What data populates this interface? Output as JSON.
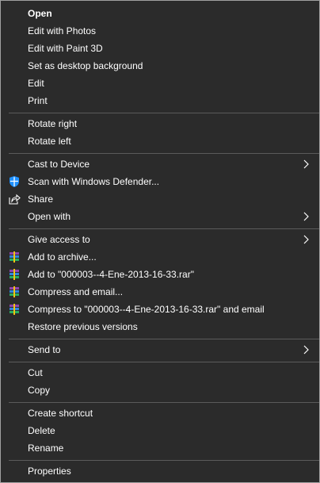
{
  "menu": {
    "items": {
      "open": "Open",
      "edit_photos": "Edit with Photos",
      "edit_paint3d": "Edit with Paint 3D",
      "set_desktop_bg": "Set as desktop background",
      "edit": "Edit",
      "print": "Print",
      "rotate_right": "Rotate right",
      "rotate_left": "Rotate left",
      "cast_to_device": "Cast to Device",
      "scan_defender": "Scan with Windows Defender...",
      "share": "Share",
      "open_with": "Open with",
      "give_access": "Give access to",
      "add_to_archive": "Add to archive...",
      "add_to_rar": "Add to \"000003--4-Ene-2013-16-33.rar\"",
      "compress_email": "Compress and email...",
      "compress_to_rar_email": "Compress to \"000003--4-Ene-2013-16-33.rar\" and email",
      "restore_versions": "Restore previous versions",
      "send_to": "Send to",
      "cut": "Cut",
      "copy": "Copy",
      "create_shortcut": "Create shortcut",
      "delete": "Delete",
      "rename": "Rename",
      "properties": "Properties"
    },
    "icons": {
      "defender": "shield-icon",
      "share": "share-icon",
      "winrar": "winrar-icon"
    },
    "colors": {
      "background": "#2b2b2b",
      "text": "#ffffff",
      "separator": "#5b5b5b",
      "defender_blue": "#1e90ff"
    }
  }
}
